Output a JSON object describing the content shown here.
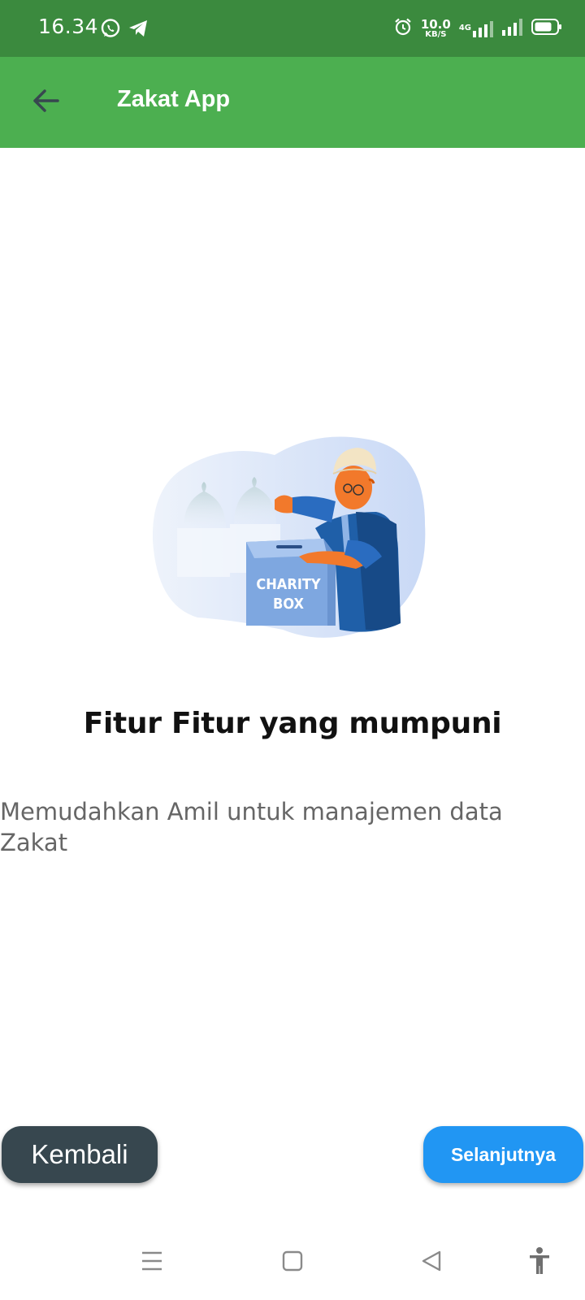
{
  "status_bar": {
    "time": "16.34",
    "net_speed_value": "10.0",
    "net_speed_unit": "KB/S",
    "network_type": "4G",
    "icons": [
      "whatsapp-icon",
      "telegram-icon",
      "alarm-icon",
      "signal-icon",
      "battery-icon"
    ]
  },
  "app_bar": {
    "title": "Zakat App",
    "back_icon": "arrow-left-icon"
  },
  "illustration": {
    "box_line1": "CHARITY",
    "box_line2": "BOX"
  },
  "content": {
    "heading": "Fitur Fitur yang mumpuni",
    "description": "Memudahkan Amil untuk manajemen data Zakat"
  },
  "buttons": {
    "back_label": "Kembali",
    "next_label": "Selanjutnya"
  },
  "nav_bar": {
    "icons": [
      "menu-icon",
      "home-square-icon",
      "back-triangle-icon",
      "accessibility-icon"
    ]
  },
  "colors": {
    "status_bar": "#3b8a3e",
    "app_bar": "#4caf50",
    "back_button": "#37474f",
    "next_button": "#2196f3"
  }
}
